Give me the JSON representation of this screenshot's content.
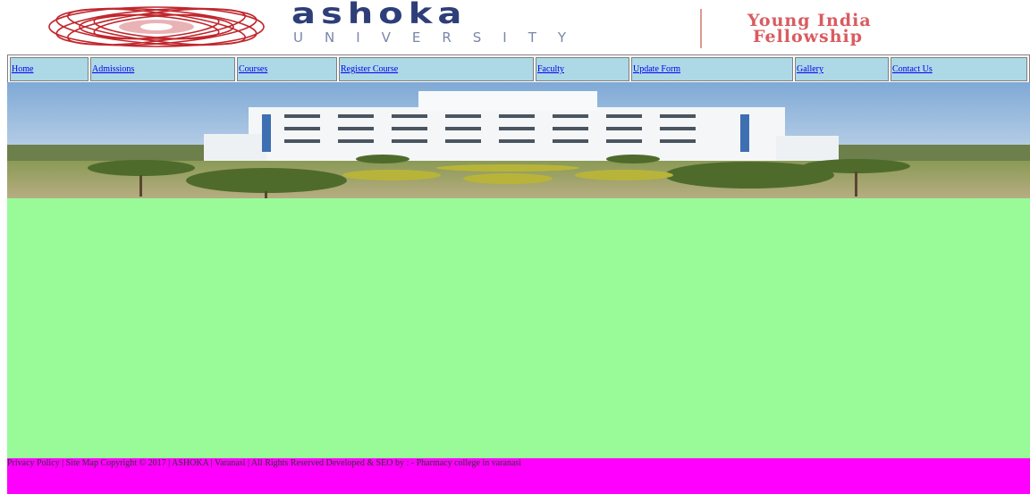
{
  "header": {
    "logo_word": "ashoka",
    "logo_sub": "UNIVERSITY",
    "tagline_line1": "Young India",
    "tagline_line2": "Fellowship"
  },
  "nav": [
    {
      "label": "Home"
    },
    {
      "label": "Admissions"
    },
    {
      "label": "Courses"
    },
    {
      "label": "Register Course"
    },
    {
      "label": "Faculty"
    },
    {
      "label": "Update Form"
    },
    {
      "label": "Gallery"
    },
    {
      "label": "Contact Us"
    }
  ],
  "footer": {
    "text": "Privacy Policy | Site Map Copyright © 2017 | ASHOKA | Varanasi | All Rights Reserved Developed & SEO by : - Pharmacy college in varanasi"
  },
  "colors": {
    "nav_bg": "#add8e6",
    "content_bg": "#98fb98",
    "footer_bg": "#ff00ff",
    "logo_blue": "#2d3e78",
    "logo_red": "#c0262d"
  }
}
